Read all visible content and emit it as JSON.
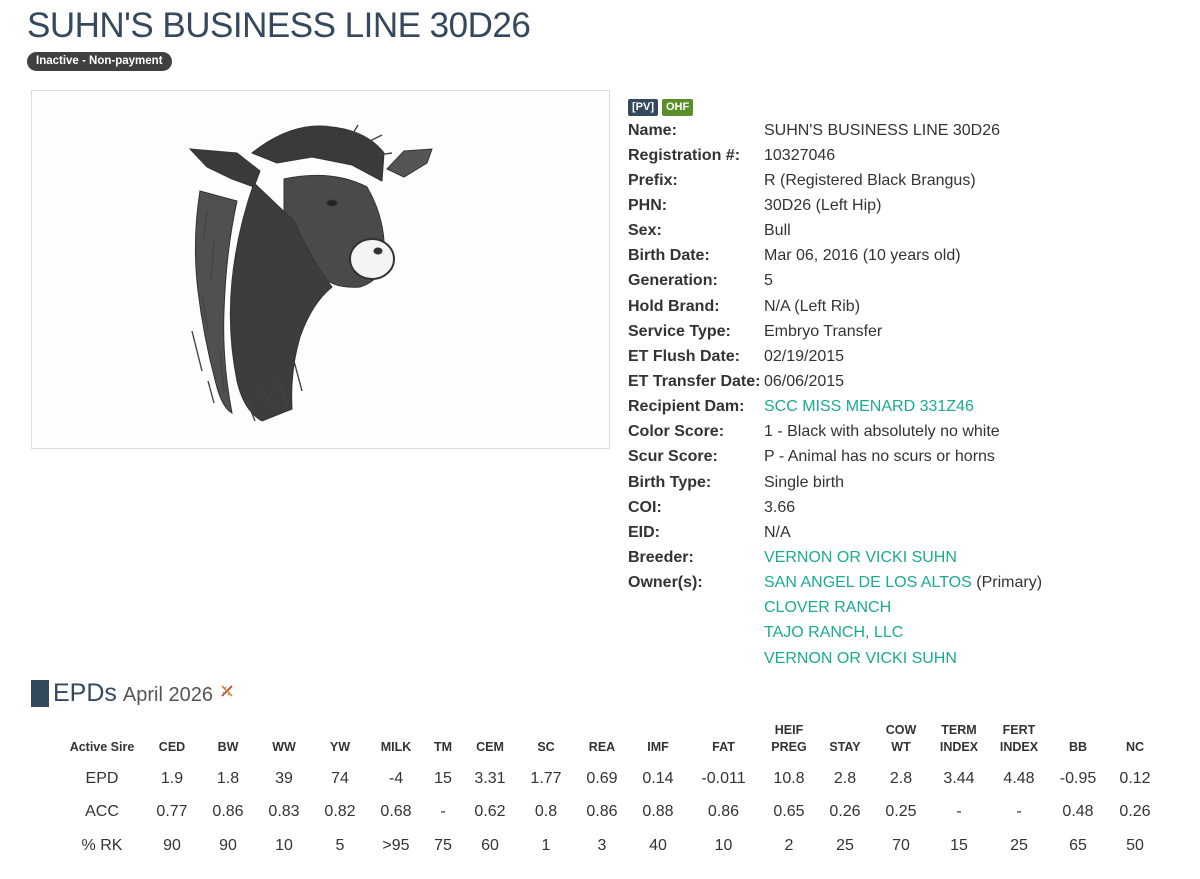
{
  "header": {
    "title": "SUHN'S BUSINESS LINE 30D26",
    "status": "Inactive - Non-payment"
  },
  "badges": {
    "pv": "[PV]",
    "ohf": "OHF"
  },
  "info": {
    "name_label": "Name:",
    "name": "SUHN'S BUSINESS LINE 30D26",
    "reg_label": "Registration #:",
    "reg": "10327046",
    "prefix_label": "Prefix:",
    "prefix": "R (Registered Black Brangus)",
    "phn_label": "PHN:",
    "phn": "30D26 (Left Hip)",
    "sex_label": "Sex:",
    "sex": "Bull",
    "birth_label": "Birth Date:",
    "birth": "Mar 06, 2016 (10 years old)",
    "gen_label": "Generation:",
    "gen": "5",
    "brand_label": "Hold Brand:",
    "brand": "N/A (Left Rib)",
    "service_label": "Service Type:",
    "service": "Embryo Transfer",
    "flush_label": "ET Flush Date:",
    "flush": "02/19/2015",
    "transfer_label": "ET Transfer Date:",
    "transfer": "06/06/2015",
    "recip_label": "Recipient Dam:",
    "recip": "SCC MISS MENARD 331Z46",
    "color_label": "Color Score:",
    "color": "1 - Black with absolutely no white",
    "scur_label": "Scur Score:",
    "scur": "P - Animal has no scurs or horns",
    "btype_label": "Birth Type:",
    "btype": "Single birth",
    "coi_label": "COI:",
    "coi": "3.66",
    "eid_label": "EID:",
    "eid": "N/A",
    "breeder_label": "Breeder:",
    "breeder": "VERNON OR VICKI SUHN",
    "owner_label": "Owner(s):",
    "owners": [
      "SAN ANGEL DE LOS ALTOS",
      "CLOVER RANCH",
      "TAJO RANCH, LLC",
      "VERNON OR VICKI SUHN"
    ],
    "owner_primary": "(Primary)"
  },
  "epd": {
    "title": "EPDs",
    "date": "April 2026",
    "icon": "dna-icon",
    "columns": [
      {
        "l1": "",
        "l2": "Active Sire"
      },
      {
        "l1": "",
        "l2": "CED"
      },
      {
        "l1": "",
        "l2": "BW"
      },
      {
        "l1": "",
        "l2": "WW"
      },
      {
        "l1": "",
        "l2": "YW"
      },
      {
        "l1": "",
        "l2": "MILK"
      },
      {
        "l1": "",
        "l2": "TM"
      },
      {
        "l1": "",
        "l2": "CEM"
      },
      {
        "l1": "",
        "l2": "SC"
      },
      {
        "l1": "",
        "l2": "REA"
      },
      {
        "l1": "",
        "l2": "IMF"
      },
      {
        "l1": "",
        "l2": "FAT"
      },
      {
        "l1": "HEIF",
        "l2": "PREG"
      },
      {
        "l1": "",
        "l2": "STAY"
      },
      {
        "l1": "COW",
        "l2": "WT"
      },
      {
        "l1": "TERM",
        "l2": "INDEX"
      },
      {
        "l1": "FERT",
        "l2": "INDEX"
      },
      {
        "l1": "",
        "l2": "BB"
      },
      {
        "l1": "",
        "l2": "NC"
      }
    ],
    "rows": [
      [
        "EPD",
        "1.9",
        "1.8",
        "39",
        "74",
        "-4",
        "15",
        "3.31",
        "1.77",
        "0.69",
        "0.14",
        "-0.011",
        "10.8",
        "2.8",
        "2.8",
        "3.44",
        "4.48",
        "-0.95",
        "0.12"
      ],
      [
        "ACC",
        "0.77",
        "0.86",
        "0.83",
        "0.82",
        "0.68",
        "-",
        "0.62",
        "0.8",
        "0.86",
        "0.88",
        "0.86",
        "0.65",
        "0.26",
        "0.25",
        "-",
        "-",
        "0.48",
        "0.26"
      ],
      [
        "% RK",
        "90",
        "90",
        "10",
        "5",
        ">95",
        "75",
        "60",
        "1",
        "3",
        "40",
        "10",
        "2",
        "25",
        "70",
        "15",
        "25",
        "65",
        "50"
      ]
    ]
  }
}
